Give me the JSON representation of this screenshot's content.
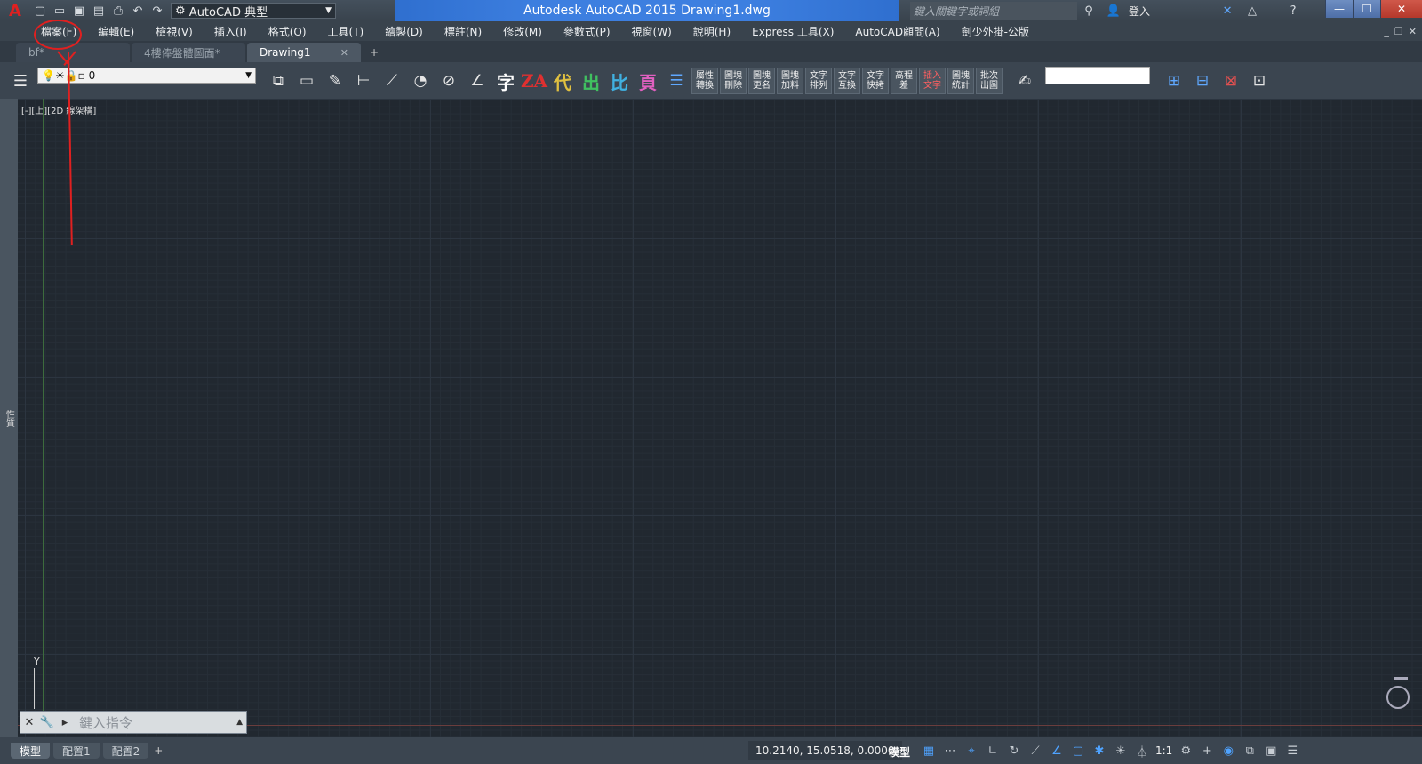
{
  "titlebar": {
    "app_logo": "A",
    "workspace": "AutoCAD 典型",
    "title": "Autodesk AutoCAD 2015    Drawing1.dwg",
    "search_placeholder": "鍵入關鍵字或詞組",
    "login_label": "登入",
    "quick_access_icons": [
      "new-icon",
      "open-icon",
      "save-icon",
      "save-as-icon",
      "print-icon",
      "undo-icon",
      "redo-icon"
    ]
  },
  "menu": {
    "items": [
      "檔案(F)",
      "編輯(E)",
      "檢視(V)",
      "插入(I)",
      "格式(O)",
      "工具(T)",
      "繪製(D)",
      "標註(N)",
      "修改(M)",
      "參數式(P)",
      "視窗(W)",
      "說明(H)",
      "Express 工具(X)",
      "AutoCAD顧問(A)",
      "劍少外掛-公版"
    ]
  },
  "tabs": [
    {
      "label": "bf*"
    },
    {
      "label": "4樓俸盤體圖面*"
    },
    {
      "label": "Drawing1"
    }
  ],
  "toolbar": {
    "layer_value": "0",
    "char_buttons": [
      "字",
      "ZA",
      "代",
      "出",
      "比",
      "頁"
    ],
    "small_buttons": [
      "屬性轉換",
      "圖塊刪除",
      "圖塊更名",
      "圖塊加料",
      "文字排列",
      "文字互換",
      "文字快拷",
      "高程差",
      "插入文字",
      "圖塊統計",
      "批次出圖"
    ]
  },
  "canvas": {
    "viewport_label": "[-][上][2D 線架構]",
    "ucs_y": "Y",
    "left_palette_label": "性質"
  },
  "commandline": {
    "placeholder": "鍵入指令"
  },
  "statusbar": {
    "layout_tabs": [
      "模型",
      "配置1",
      "配置2"
    ],
    "coordinates": "10.2140, 15.0518, 0.0000",
    "model_label": "模型",
    "annotation_scale": "1:1"
  },
  "colors": {
    "accent_title": "#3d7fe0",
    "annotation_red": "#e02020",
    "canvas_bg": "#212830"
  }
}
